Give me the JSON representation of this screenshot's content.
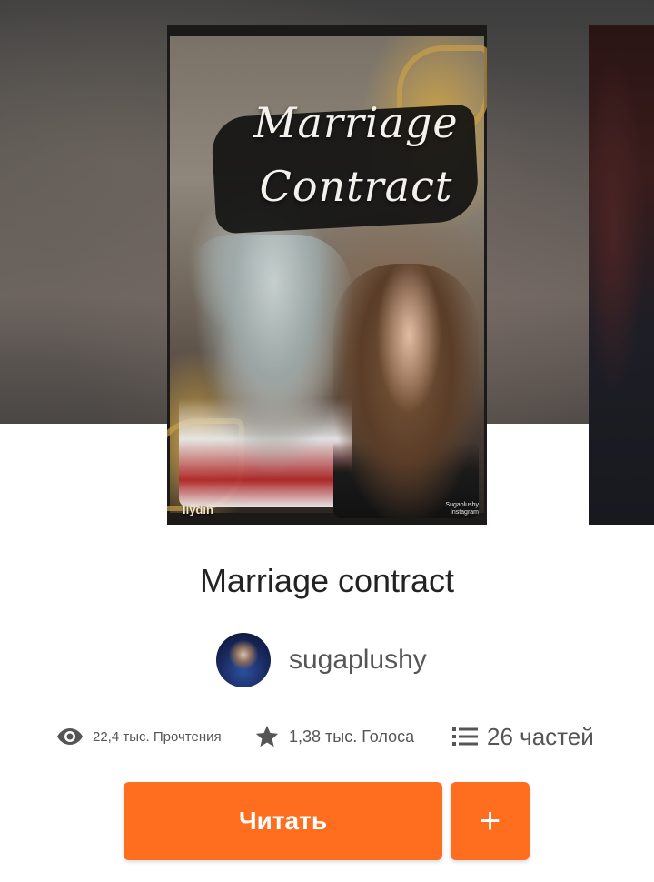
{
  "cover": {
    "title_text": "Marriage Contract",
    "author_mark": "llydin",
    "credit_line1": "Sugaplushy",
    "credit_line2": "Instagram"
  },
  "book": {
    "title": "Marriage contract"
  },
  "author": {
    "name": "sugaplushy"
  },
  "stats": {
    "views": "22,4 тыс. Прочтения",
    "votes": "1,38 тыс. Голоса",
    "parts": "26 частей"
  },
  "actions": {
    "read_label": "Читать",
    "add_label": "+"
  },
  "colors": {
    "accent": "#ff6d1f",
    "text_primary": "#222222",
    "text_secondary": "#555555"
  },
  "icons": {
    "views": "eye-icon",
    "votes": "star-icon",
    "parts": "list-icon"
  }
}
